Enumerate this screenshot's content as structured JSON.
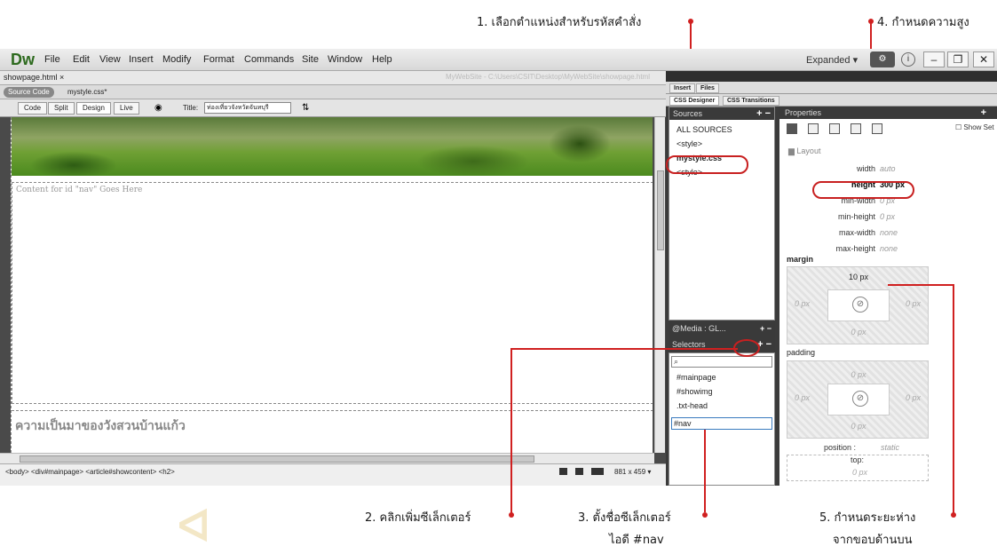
{
  "annotations": {
    "step1": "1. เลือกตำแหน่งสำหรับรหัสคำสั่ง",
    "step2": "2. คลิกเพิ่มซีเล็กเตอร์",
    "step3_line1": "3. ตั้งชื่อซีเล็กเตอร์",
    "step3_line2": "ไอดี #nav",
    "step4": "4. กำหนดความสูง",
    "step5_line1": "5. กำหนดระยะห่าง",
    "step5_line2": "จากขอบด้านบน"
  },
  "app": {
    "logo": "Dw",
    "menu": [
      "File",
      "Edit",
      "View",
      "Insert",
      "Modify",
      "Format",
      "Commands",
      "Site",
      "Window",
      "Help"
    ],
    "workspace": "Expanded",
    "workspace_arrow": "▾"
  },
  "document": {
    "tab": "showpage.html ×",
    "path": "MyWebSite - C:\\Users\\CSIT\\Desktop\\MyWebSite\\showpage.html",
    "source_code": "Source Code",
    "related_file": "mystyle.css*",
    "views": [
      "Code",
      "Split",
      "Design",
      "Live"
    ],
    "title_label": "Title:",
    "title_value": "ท่องเที่ยวจังหวัดจันทบุรี",
    "nav_placeholder": "Content for id \"nav\" Goes Here",
    "heading": "ความเป็นมาของวังสวนบ้านแก้ว",
    "tag_selector": "<body> <div#mainpage> <article#showcontent> <h2>",
    "window_size": "881 x 459 ▾"
  },
  "panels": {
    "tabs_top": [
      "Insert",
      "Files"
    ],
    "tabs_css": [
      "CSS Designer",
      "CSS Transitions"
    ],
    "sources_title": "Sources",
    "sources": [
      "ALL SOURCES",
      "<style>",
      "mystyle.css",
      "<style>"
    ],
    "media_title": "@Media : GL...",
    "selectors_title": "Selectors",
    "selectors": [
      "#mainpage",
      "#showimg",
      ".txt-head",
      "#nav"
    ],
    "properties_title": "Properties",
    "show_set": "Show Set",
    "layout_label": "Layout",
    "layout_props": [
      {
        "name": "width",
        "value": "auto",
        "set": false
      },
      {
        "name": "height",
        "value": "300 px",
        "set": true
      },
      {
        "name": "min-width",
        "value": "0 px",
        "set": false
      },
      {
        "name": "min-height",
        "value": "0 px",
        "set": false
      },
      {
        "name": "max-width",
        "value": "none",
        "set": false
      },
      {
        "name": "max-height",
        "value": "none",
        "set": false
      }
    ],
    "margin_label": "margin",
    "margin": {
      "top": "10 px",
      "right": "0 px",
      "bottom": "0 px",
      "left": "0 px"
    },
    "padding_label": "padding",
    "padding": {
      "top": "0 px",
      "right": "0 px",
      "bottom": "0 px",
      "left": "0 px"
    },
    "position_label": "position :",
    "position_value": "static",
    "top_label": "top:",
    "top_value": "0 px"
  },
  "colors": {
    "annotation_red": "#d02020",
    "dw_green": "#2d6a1e"
  }
}
